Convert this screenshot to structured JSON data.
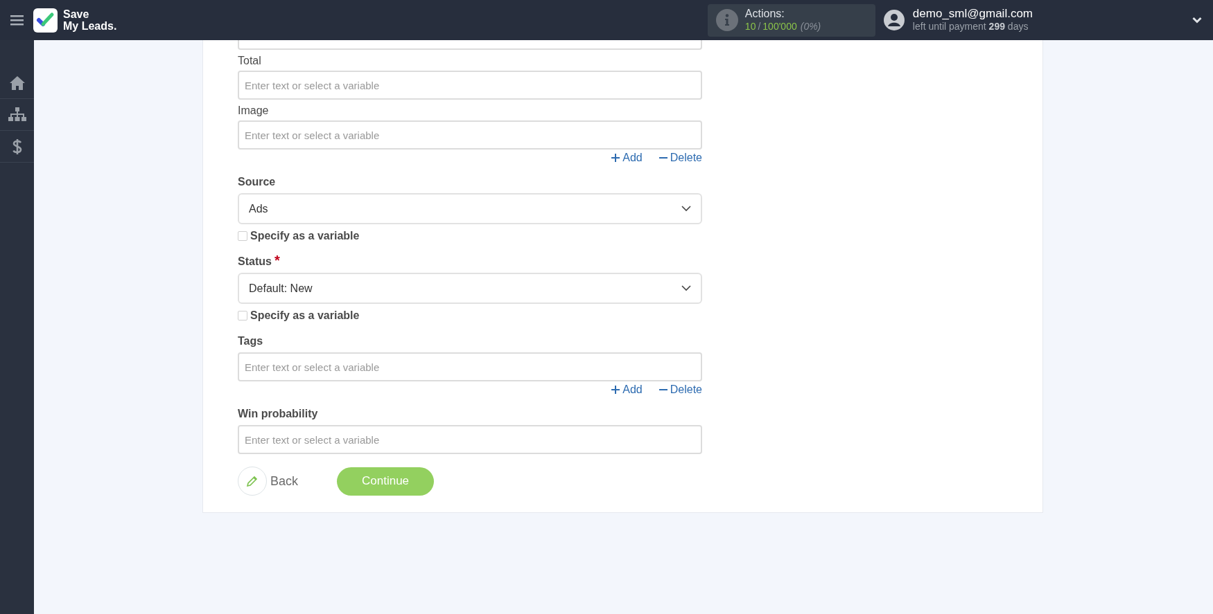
{
  "header": {
    "logo_lines": [
      "Save",
      "My Leads."
    ],
    "actions": {
      "label": "Actions:",
      "used": "10",
      "separator": "/",
      "limit": "100'000",
      "percent": "(0%)"
    },
    "account": {
      "email": "demo_sml@gmail.com",
      "payment": "left until payment **299** days"
    }
  },
  "sidebar": {
    "items": [
      {
        "kind": "home"
      },
      {
        "kind": "sitemap"
      },
      {
        "kind": "dollar"
      }
    ]
  },
  "fields": [
    {
      "kind": "stub"
    },
    {
      "kind": "subtext",
      "label": "Total",
      "placeholder": "Enter text or select a variable"
    },
    {
      "kind": "subtext",
      "label": "Image",
      "placeholder": "Enter text or select a variable",
      "links": [
        {
          "kind": "add",
          "label": "Add"
        },
        {
          "kind": "delete",
          "label": "Delete"
        }
      ]
    },
    {
      "kind": "select",
      "label": "Source",
      "value": "Ads",
      "specify": {
        "label": "Specify as a variable",
        "checked": false
      }
    },
    {
      "kind": "select",
      "label": "Status",
      "value": "Default: New",
      "marker": "*",
      "specify": {
        "label": "Specify as a variable",
        "checked": false
      }
    },
    {
      "kind": "text",
      "label": "Tags",
      "placeholder": "Enter text or select a variable",
      "links": [
        {
          "kind": "add",
          "label": "Add"
        },
        {
          "kind": "delete",
          "label": "Delete"
        }
      ]
    },
    {
      "kind": "text",
      "label": "Win probability",
      "placeholder": "Enter text or select a variable"
    }
  ],
  "buttons": {
    "back": "Back",
    "continue": "Continue"
  }
}
